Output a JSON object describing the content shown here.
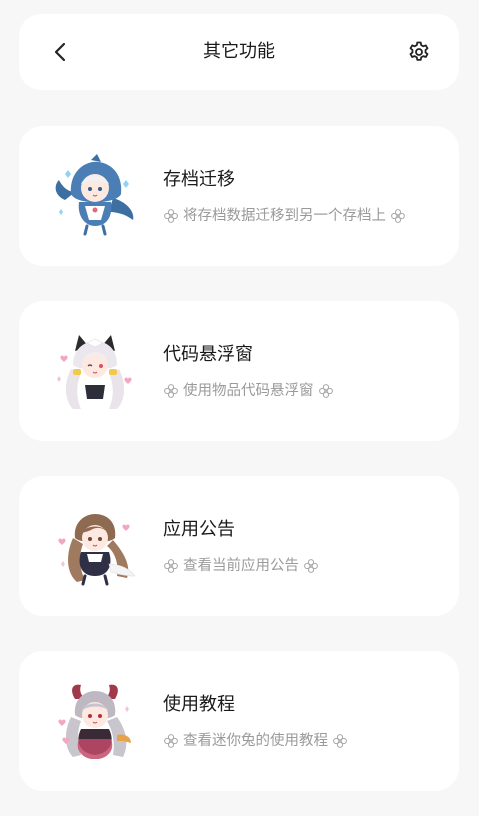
{
  "header": {
    "title": "其它功能",
    "back_icon": "chevron-left-icon",
    "settings_icon": "gear-icon"
  },
  "cards": [
    {
      "title": "存档迁移",
      "desc": "将存档数据迁移到另一个存档上",
      "art": "shark-hood-chibi-illustration"
    },
    {
      "title": "代码悬浮窗",
      "desc": "使用物品代码悬浮窗",
      "art": "cat-ear-maid-chibi-illustration"
    },
    {
      "title": "应用公告",
      "desc": "查看当前应用公告",
      "art": "brown-hair-chibi-illustration"
    },
    {
      "title": "使用教程",
      "desc": "查看迷你兔的使用教程",
      "art": "horned-gray-hair-chibi-illustration"
    }
  ],
  "colors": {
    "background": "#f7f7f7",
    "card": "#ffffff",
    "title_text": "#1a1a1a",
    "desc_text": "#9a9a9a"
  }
}
